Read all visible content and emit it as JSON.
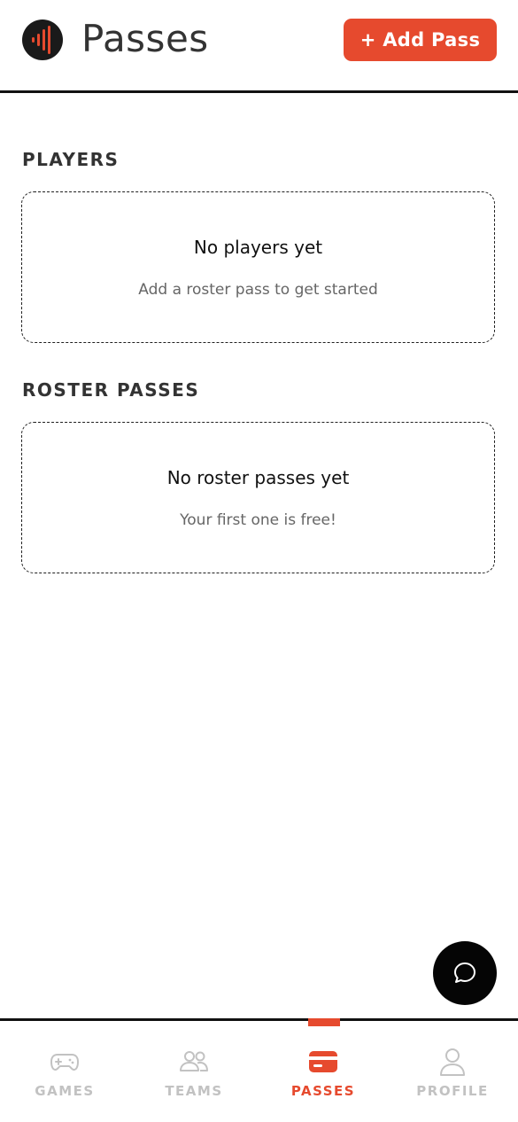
{
  "header": {
    "title": "Passes",
    "add_button_label": "+ Add Pass",
    "logo_icon": "sound-bars-logo-icon"
  },
  "sections": {
    "players": {
      "title": "PLAYERS",
      "empty_title": "No players yet",
      "empty_subtitle": "Add a roster pass to get started"
    },
    "roster_passes": {
      "title": "ROSTER PASSES",
      "empty_title": "No roster passes yet",
      "empty_subtitle": "Your first one is free!"
    }
  },
  "chat": {
    "icon": "chat-bubble-icon"
  },
  "bottom_nav": {
    "active": "passes",
    "items": [
      {
        "label": "GAMES",
        "icon": "gamepad-icon"
      },
      {
        "label": "TEAMS",
        "icon": "users-icon"
      },
      {
        "label": "PASSES",
        "icon": "pass-card-icon"
      },
      {
        "label": "PROFILE",
        "icon": "user-icon"
      }
    ]
  },
  "colors": {
    "accent": "#e64a2e",
    "inactive_nav": "#c2c2c2",
    "text_dark": "#333333",
    "text_muted": "#666666"
  }
}
